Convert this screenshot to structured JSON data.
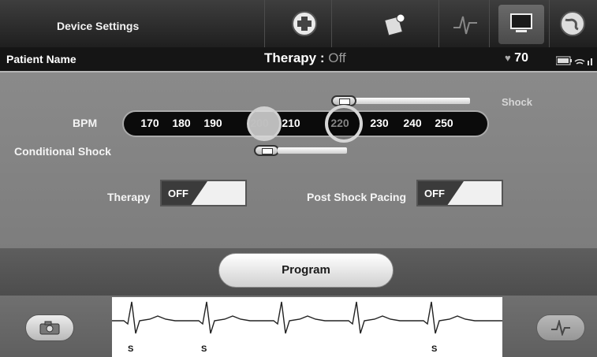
{
  "top_menu": {
    "title": "Device Settings",
    "icons": [
      "medical-cross-icon",
      "pill-box-icon",
      "ecg-trend-icon",
      "monitor-icon",
      "globe-icon"
    ],
    "active_icon": "monitor-icon"
  },
  "status_bar": {
    "patient_label": "Patient Name",
    "therapy_label": "Therapy :",
    "therapy_value": "Off",
    "heart_rate": "70"
  },
  "settings": {
    "bpm_label": "BPM",
    "bpm_values": [
      "170",
      "180",
      "190",
      "200",
      "210",
      "220",
      "230",
      "240",
      "250"
    ],
    "conditional_shock_selected": "200",
    "shock_selected": "220",
    "shock_label": "Shock",
    "conditional_shock_label": "Conditional Shock",
    "therapy_label": "Therapy",
    "therapy_toggle": "OFF",
    "post_shock_pacing_label": "Post Shock Pacing",
    "post_shock_pacing_toggle": "OFF"
  },
  "program": {
    "label": "Program"
  },
  "ecg": {
    "markers": [
      "S",
      "S",
      "S"
    ]
  },
  "colors": {
    "panel_gray": "#828282",
    "status_black": "#151515",
    "accent_white": "#ffffff"
  }
}
